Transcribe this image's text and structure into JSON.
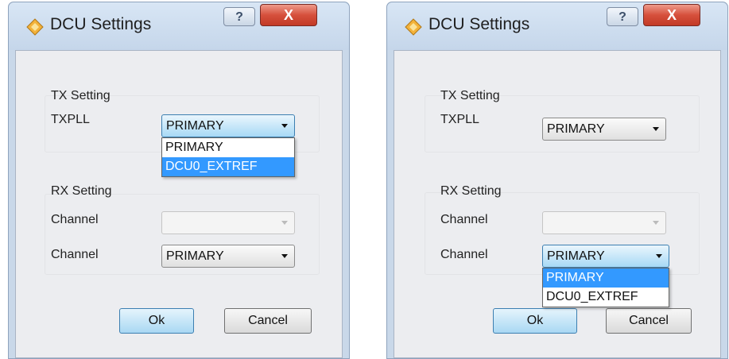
{
  "dialogs": [
    {
      "title": "DCU Settings",
      "help_glyph": "?",
      "close_glyph": "X",
      "tx": {
        "group_label": "TX Setting",
        "field_label": "TXPLL",
        "value": "PRIMARY",
        "dropdown_open": true
      },
      "rx": {
        "group_label": "RX Setting",
        "channel1_label": "Channel",
        "channel1_value": "",
        "channel2_label": "Channel",
        "channel2_value": "PRIMARY"
      },
      "dropdown_options": [
        "PRIMARY",
        "DCU0_EXTREF"
      ],
      "highlighted_option": "DCU0_EXTREF",
      "ok_label": "Ok",
      "cancel_label": "Cancel"
    },
    {
      "title": "DCU Settings",
      "help_glyph": "?",
      "close_glyph": "X",
      "tx": {
        "group_label": "TX Setting",
        "field_label": "TXPLL",
        "value": "PRIMARY"
      },
      "rx": {
        "group_label": "RX Setting",
        "channel1_label": "Channel",
        "channel1_value": "",
        "channel2_label": "Channel",
        "channel2_value": "PRIMARY",
        "dropdown_open": true
      },
      "dropdown_options": [
        "PRIMARY",
        "DCU0_EXTREF"
      ],
      "highlighted_option": "PRIMARY",
      "ok_label": "Ok",
      "cancel_label": "Cancel"
    }
  ],
  "colors": {
    "client_bg": "#ecedf0",
    "frame": "#c9d8e9",
    "selection": "#3399ff",
    "close_red": "#c23a26"
  },
  "icons": [
    "dcu-settings-app-icon",
    "help-icon",
    "close-icon",
    "chevron-down-icon"
  ]
}
